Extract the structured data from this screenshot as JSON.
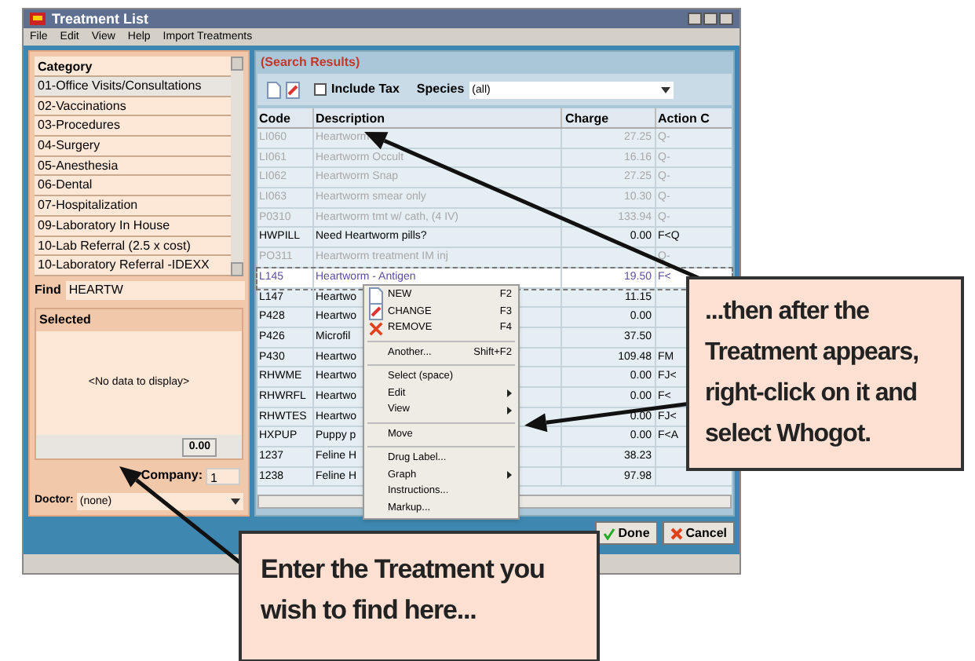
{
  "window": {
    "title": "Treatment List"
  },
  "menu": [
    "File",
    "Edit",
    "View",
    "Help",
    "Import Treatments"
  ],
  "category_panel": {
    "header": "Category",
    "items": [
      {
        "label": "01-Office Visits/Consultations",
        "selected": true
      },
      {
        "label": "02-Vaccinations",
        "selected": false
      },
      {
        "label": "03-Procedures",
        "selected": false
      },
      {
        "label": "04-Surgery",
        "selected": false
      },
      {
        "label": "05-Anesthesia",
        "selected": false
      },
      {
        "label": "06-Dental",
        "selected": false
      },
      {
        "label": "07-Hospitalization",
        "selected": false
      },
      {
        "label": "09-Laboratory In House",
        "selected": false
      },
      {
        "label": "10-Lab Referral (2.5 x cost)",
        "selected": false
      },
      {
        "label": "10-Laboratory Referral -IDEXX",
        "selected": false
      }
    ]
  },
  "find": {
    "label": "Find",
    "value": "HEARTW"
  },
  "selected_panel": {
    "header": "Selected",
    "empty_text": "<No data to display>",
    "total": "0.00"
  },
  "company": {
    "label": "Company:",
    "value": "1"
  },
  "doctor": {
    "label": "Doctor:",
    "value": "(none)"
  },
  "results": {
    "title": "(Search Results)",
    "include_tax": {
      "label": "Include Tax",
      "checked": false
    },
    "species": {
      "label": "Species",
      "value": "(all)"
    },
    "columns": [
      "Code",
      "Description",
      "Charge",
      "Action C"
    ],
    "rows": [
      {
        "code": "LI060",
        "description": "Heartworm",
        "charge": "27.25",
        "action": "Q-",
        "inactive": true,
        "selected": false
      },
      {
        "code": "LI061",
        "description": "Heartworm Occult",
        "charge": "16.16",
        "action": "Q-",
        "inactive": true,
        "selected": false
      },
      {
        "code": "LI062",
        "description": "Heartworm Snap",
        "charge": "27.25",
        "action": "Q-",
        "inactive": true,
        "selected": false
      },
      {
        "code": "LI063",
        "description": "Heartworm smear only",
        "charge": "10.30",
        "action": "Q-",
        "inactive": true,
        "selected": false
      },
      {
        "code": "P0310",
        "description": "Heartworm tmt w/ cath, (4 IV)",
        "charge": "133.94",
        "action": "Q-",
        "inactive": true,
        "selected": false
      },
      {
        "code": "HWPILL",
        "description": "Need Heartworm pills?",
        "charge": "0.00",
        "action": "F<Q",
        "inactive": false,
        "selected": false
      },
      {
        "code": "PO311",
        "description": "Heartworm treatment IM inj",
        "action": "Q-",
        "inactive": true,
        "selected": false
      },
      {
        "code": "L145",
        "description": "Heartworm - Antigen",
        "charge": "19.50",
        "action": "F<",
        "inactive": false,
        "selected": true
      },
      {
        "code": "L147",
        "description": "Heartwo",
        "charge": "11.15",
        "action": "",
        "inactive": false,
        "selected": false
      },
      {
        "code": "P428",
        "description": "Heartwo",
        "charge": "0.00",
        "action": "",
        "inactive": false,
        "selected": false
      },
      {
        "code": "P426",
        "description": "Microfil",
        "charge": "37.50",
        "action": "",
        "inactive": false,
        "selected": false
      },
      {
        "code": "P430",
        "description": "Heartwo",
        "charge": "109.48",
        "action": "FM",
        "inactive": false,
        "selected": false
      },
      {
        "code": "RHWME",
        "description": "Heartwo",
        "charge": "0.00",
        "action": "FJ<",
        "inactive": false,
        "selected": false
      },
      {
        "code": "RHWRFL",
        "description": "Heartwo",
        "charge": "0.00",
        "action": "F<",
        "inactive": false,
        "selected": false
      },
      {
        "code": "RHWTES",
        "description": "Heartwo",
        "charge": "0.00",
        "action": "FJ<",
        "inactive": false,
        "selected": false
      },
      {
        "code": "HXPUP",
        "description": "Puppy p",
        "charge": "0.00",
        "action": "F<A",
        "inactive": false,
        "selected": false
      },
      {
        "code": "1237",
        "description": "Feline H",
        "charge": "38.23",
        "action": "",
        "inactive": false,
        "selected": false
      },
      {
        "code": "1238",
        "description": "Feline H",
        "charge": "97.98",
        "action": "",
        "inactive": false,
        "selected": false
      }
    ]
  },
  "buttons": [
    {
      "label": "Done",
      "kind": "done"
    },
    {
      "label": "Cancel",
      "kind": "cancel"
    }
  ],
  "context_menu": [
    {
      "kind": "item",
      "label": "NEW",
      "shortcut": "F2"
    },
    {
      "kind": "item",
      "label": "CHANGE",
      "shortcut": "F3"
    },
    {
      "kind": "item",
      "label": "REMOVE",
      "shortcut": "F4"
    },
    {
      "kind": "separator"
    },
    {
      "kind": "item",
      "label": "Another...",
      "shortcut": "Shift+F2"
    },
    {
      "kind": "separator"
    },
    {
      "kind": "item",
      "label": "Select (space)"
    },
    {
      "kind": "submenu",
      "label": "Edit"
    },
    {
      "kind": "submenu",
      "label": "View"
    },
    {
      "kind": "separator"
    },
    {
      "kind": "item",
      "label": "Move"
    },
    {
      "kind": "separator"
    },
    {
      "kind": "item",
      "label": "Drug Label..."
    },
    {
      "kind": "submenu",
      "label": "Graph"
    },
    {
      "kind": "item",
      "label": "Instructions..."
    },
    {
      "kind": "item",
      "label": "Markup..."
    }
  ],
  "callouts": [
    {
      "kind": "side",
      "text": "...then after the Treatment appears, right-click on it and select **Whogot**."
    },
    {
      "kind": "bottom",
      "text": "Enter the Treatment you wish to find here..."
    }
  ]
}
